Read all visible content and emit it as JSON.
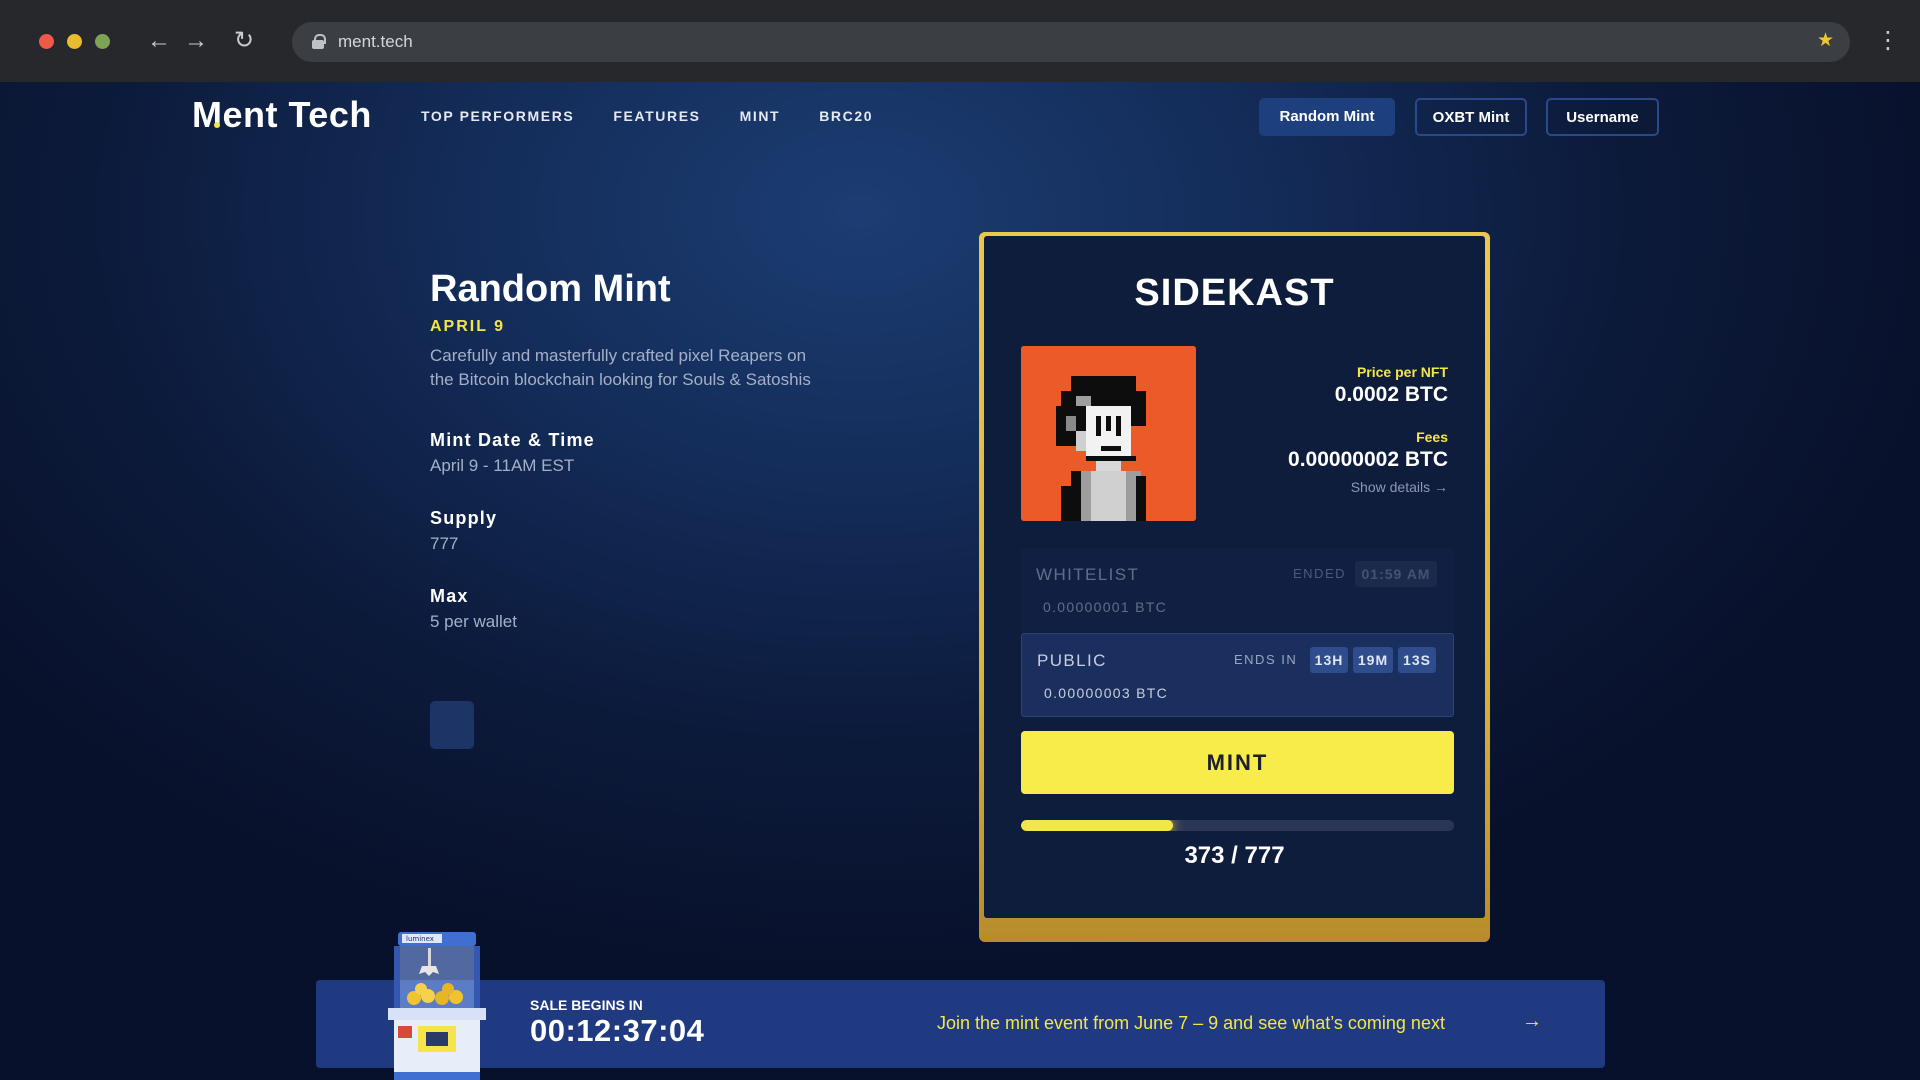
{
  "browser": {
    "url": "ment.tech"
  },
  "header": {
    "logo": "Ment Tech",
    "nav": [
      "TOP PERFORMERS",
      "FEATURES",
      "MINT",
      "BRC20"
    ],
    "buttons": {
      "random_mint": "Random Mint",
      "oxbt_mint": "OXBT Mint",
      "username": "Username"
    }
  },
  "info": {
    "title": "Random Mint",
    "date_tag": "APRIL 9",
    "description": "Carefully and masterfully crafted pixel Reapers on the Bitcoin blockchain looking for Souls & Satoshis",
    "specs": [
      {
        "label": "Mint Date & Time",
        "value": "April 9 - 11AM EST"
      },
      {
        "label": "Supply",
        "value": "777"
      },
      {
        "label": "Max",
        "value": "5 per wallet"
      }
    ]
  },
  "card": {
    "title": "SIDEKAST",
    "price_label": "Price per NFT",
    "price": "0.0002 BTC",
    "fees_label": "Fees",
    "fees": "0.00000002 BTC",
    "show_details": "Show details →",
    "whitelist": {
      "name": "WHITELIST",
      "status": "ENDED",
      "time": "01:59 AM",
      "price": "0.00000001 BTC"
    },
    "public": {
      "name": "PUBLIC",
      "status": "ENDS IN",
      "hours": "13H",
      "minutes": "19M",
      "seconds": "13S",
      "price": "0.00000003 BTC"
    },
    "mint_button": "MINT",
    "progress_text": "373 / 777",
    "progress_fraction": 0.35
  },
  "banner": {
    "sale_label": "SALE BEGINS IN",
    "countdown": "00:12:37:04",
    "join_text": "Join the mint event from June 7 – 9 and see what’s coming next",
    "arrow": "→",
    "machine_label": "luminex"
  },
  "colors": {
    "accent_yellow": "#f4e64a",
    "nft_background": "#ec5a27",
    "banner_blue": "#1f3a80"
  },
  "icons": [
    "back-arrow-icon",
    "forward-arrow-icon",
    "reload-icon",
    "lock-icon",
    "star-icon",
    "kebab-menu-icon",
    "arrow-right-icon"
  ]
}
